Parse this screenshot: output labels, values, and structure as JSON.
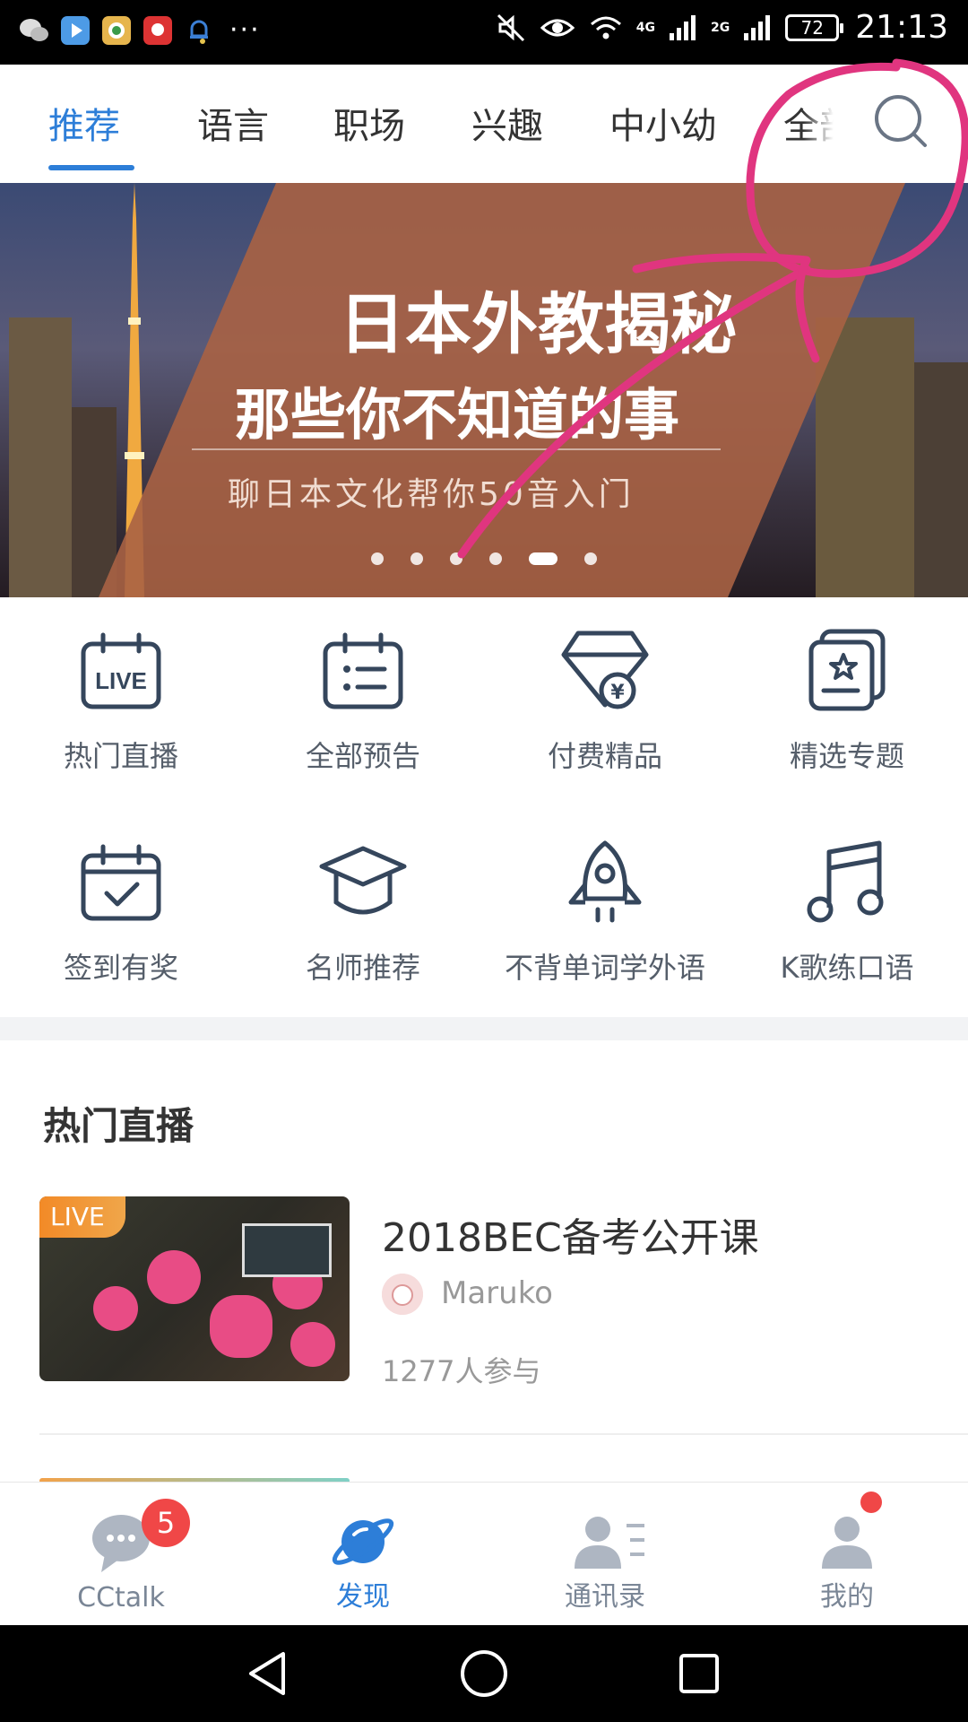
{
  "status_bar": {
    "time": "21:13",
    "battery": "72",
    "net1": "4G",
    "net2": "2G",
    "more": "···"
  },
  "tabs": [
    {
      "label": "推荐"
    },
    {
      "label": "语言"
    },
    {
      "label": "职场"
    },
    {
      "label": "兴趣"
    },
    {
      "label": "中小幼"
    },
    {
      "label": "全部"
    }
  ],
  "banner": {
    "title": "日本外教揭秘",
    "subtitle": "那些你不知道的事",
    "caption": "聊日本文化帮你50音入门",
    "slide_count": 6,
    "active_slide": 5
  },
  "features": [
    {
      "label": "热门直播",
      "icon": "live-calendar-icon"
    },
    {
      "label": "全部预告",
      "icon": "schedule-icon"
    },
    {
      "label": "付费精品",
      "icon": "diamond-yen-icon"
    },
    {
      "label": "精选专题",
      "icon": "featured-topic-icon"
    },
    {
      "label": "签到有奖",
      "icon": "checkin-calendar-icon"
    },
    {
      "label": "名师推荐",
      "icon": "graduation-cap-icon"
    },
    {
      "label": "不背单词学外语",
      "icon": "rocket-icon"
    },
    {
      "label": "K歌练口语",
      "icon": "music-note-icon"
    }
  ],
  "hot_live": {
    "title": "热门直播",
    "items": [
      {
        "badge": "LIVE",
        "title": "2018BEC备考公开课",
        "author": "Maruko",
        "participants": "1277人参与"
      }
    ]
  },
  "bottom_nav": [
    {
      "label": "CCtalk",
      "badge": "5"
    },
    {
      "label": "发现"
    },
    {
      "label": "通讯录"
    },
    {
      "label": "我的"
    }
  ],
  "colors": {
    "accent": "#2d7ed8",
    "badge": "#f04747",
    "annotation": "#e0357f"
  }
}
